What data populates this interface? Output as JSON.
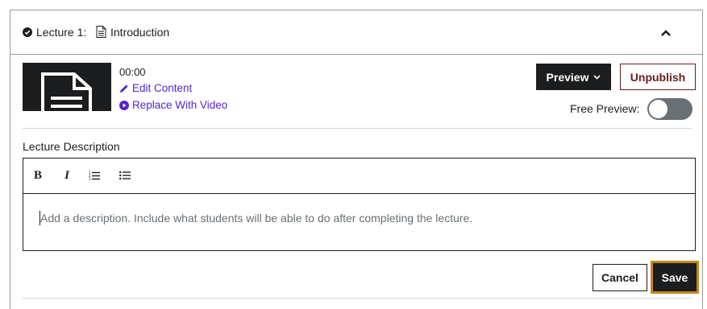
{
  "header": {
    "lecture_label": "Lecture 1:",
    "title": "Introduction",
    "status_icon": "check-circle-icon",
    "type_icon": "document-icon",
    "toggle_icon": "chevron-up-icon"
  },
  "content": {
    "duration": "00:00",
    "edit_link": "Edit Content",
    "replace_link": "Replace With Video",
    "preview_button": "Preview",
    "unpublish_button": "Unpublish",
    "free_preview_label": "Free Preview:",
    "free_preview_enabled": false
  },
  "description": {
    "label": "Lecture Description",
    "placeholder": "Add a description. Include what students will be able to do after completing the lecture.",
    "toolbar": {
      "bold": "B",
      "italic": "I",
      "ordered_list_icon": "ordered-list-icon",
      "unordered_list_icon": "unordered-list-icon"
    }
  },
  "actions": {
    "cancel": "Cancel",
    "save": "Save"
  },
  "colors": {
    "accent": "#5624d0",
    "dark": "#1c1d1f",
    "unpublish": "#6a1b1b",
    "focus": "#c4871a",
    "toggle_off": "#6a6f73"
  }
}
